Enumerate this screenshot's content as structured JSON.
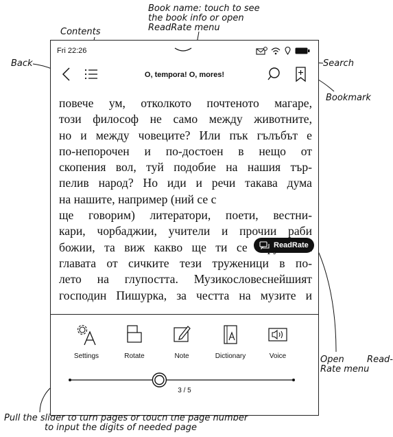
{
  "annotations": {
    "book_name": [
      "Book name: touch to see",
      "the book info or open",
      "ReadRate menu"
    ],
    "contents": "Contents",
    "back": "Back",
    "search": "Search",
    "bookmark": "Bookmark",
    "open_readrate": [
      "Open",
      "Read-",
      "Rate menu"
    ],
    "slider_hint": [
      "Pull the slider to turn pages or touch the page number",
      "to input the digits of needed page"
    ]
  },
  "status": {
    "time": "Fri 22:26"
  },
  "topbar": {
    "book_title": "O, tempora! O, mores!"
  },
  "reading": {
    "lines": [
      "повече ум, отколкото почтеното магаре,",
      "този философ не само между животните,",
      "но и между човеците? Или пък гълъбът е",
      "по-непорочен и по-достоен в нещо от",
      "скопения вол, туй подобие на нашия тър-",
      "пелив народ? Но иди и речи такава дума",
      "на нашите, например (ний се с",
      "ще говорим) литератори, поети, вестни-",
      "кари, чорбаджии, учители и прочии раби",
      "божии, та виж какво ще ти се струпа на",
      "главата от сичките тези труженици в по-",
      "лето на глупостта. Музикословеснейшият",
      "господин Пишурка, за честта на музите и"
    ]
  },
  "readrate": {
    "label": "ReadRate"
  },
  "tools": [
    {
      "label": "Settings",
      "icon": "settings-icon"
    },
    {
      "label": "Rotate",
      "icon": "rotate-icon"
    },
    {
      "label": "Note",
      "icon": "note-icon"
    },
    {
      "label": "Dictionary",
      "icon": "dictionary-icon"
    },
    {
      "label": "Voice",
      "icon": "voice-icon"
    }
  ],
  "pager": {
    "page": "3 / 5",
    "progress": 0.4
  }
}
